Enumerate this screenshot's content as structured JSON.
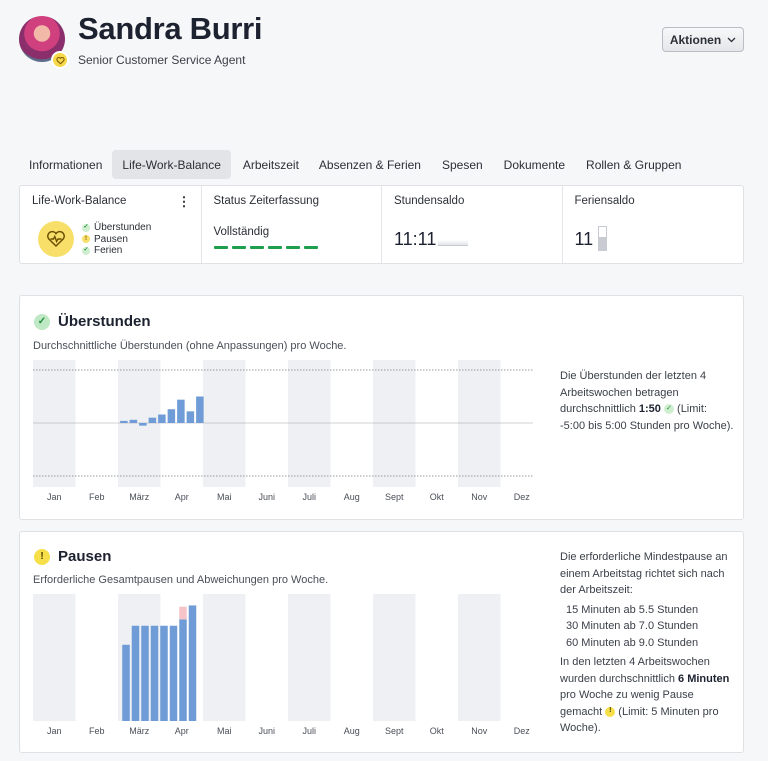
{
  "profile": {
    "name": "Sandra Burri",
    "role": "Senior Customer Service Agent",
    "actions_label": "Aktionen"
  },
  "tabs": [
    {
      "label": "Informationen",
      "active": false
    },
    {
      "label": "Life-Work-Balance",
      "active": true
    },
    {
      "label": "Arbeitszeit",
      "active": false
    },
    {
      "label": "Absenzen & Ferien",
      "active": false
    },
    {
      "label": "Spesen",
      "active": false
    },
    {
      "label": "Dokumente",
      "active": false
    },
    {
      "label": "Rollen & Gruppen",
      "active": false
    }
  ],
  "summary": {
    "lwb": {
      "title": "Life-Work-Balance",
      "items": [
        {
          "label": "Überstunden",
          "status": "ok"
        },
        {
          "label": "Pausen",
          "status": "warning"
        },
        {
          "label": "Ferien",
          "status": "ok"
        }
      ]
    },
    "status": {
      "title": "Status Zeiterfassung",
      "value": "Vollständig"
    },
    "stundensaldo": {
      "title": "Stundensaldo",
      "value": "11:11"
    },
    "feriensaldo": {
      "title": "Feriensaldo",
      "value": "11",
      "gauge_fraction": 0.55
    }
  },
  "ueberstunden": {
    "title": "Überstunden",
    "subtitle": "Durchschnittliche Überstunden (ohne Anpassungen) pro Woche.",
    "text_1": "Die Überstunden der letzten 4 Arbeitswochen betragen durchschnittlich ",
    "avg": "1:50",
    "text_2": " (Limit: -5:00 bis 5:00 Stunden pro Woche)."
  },
  "pausen": {
    "title": "Pausen",
    "subtitle": "Erforderliche Gesamtpausen und Abweichungen pro Woche.",
    "intro": "Die erforderliche Mindestpause an einem Arbeitstag richtet sich nach der Arbeitszeit:",
    "rules": [
      "15 Minuten ab 5.5 Stunden",
      "30 Minuten ab 7.0 Stunden",
      "60 Minuten ab 9.0 Stunden"
    ],
    "text_1": "In den letzten 4 Arbeitswochen wurden durchschnittlich ",
    "avg": "6 Minuten",
    "text_2": " pro Woche zu wenig Pause gemacht ",
    "text_3": " (Limit: 5 Minuten pro Woche)."
  },
  "chart_data": [
    {
      "type": "bar",
      "categories": [
        "Jan",
        "Feb",
        "März",
        "Apr",
        "Mai",
        "Juni",
        "Juli",
        "Aug",
        "Sept",
        "Okt",
        "Nov",
        "Dez"
      ],
      "weeks_start_month": 2.05,
      "series": [
        {
          "values": [
            0.2,
            0.3,
            -0.25,
            0.5,
            0.8,
            1.3,
            2.2,
            1.1,
            2.5
          ]
        }
      ],
      "ylim": [
        -5.0,
        5.0
      ],
      "reference_lines": [
        -5.0,
        0,
        5.0
      ],
      "grid": false,
      "colors": {
        "bar": "#6f9bd6",
        "band": "#eef0f3",
        "line": "#8c9096"
      }
    },
    {
      "type": "bar",
      "categories": [
        "Jan",
        "Feb",
        "März",
        "Apr",
        "Mai",
        "Juni",
        "Juli",
        "Aug",
        "Sept",
        "Okt",
        "Nov",
        "Dez"
      ],
      "weeks_start_month": 2.1,
      "series": [
        {
          "name": "Pausen",
          "values": [
            60,
            75,
            75,
            75,
            75,
            75,
            80,
            91
          ]
        },
        {
          "name": "Abweichung",
          "values": [
            0,
            0,
            0,
            0,
            0,
            0,
            10,
            0
          ]
        }
      ],
      "ylim": [
        0,
        100
      ],
      "grid": false,
      "colors": {
        "bar": "#6f9bd6",
        "deviation": "#f6c3c9",
        "band": "#eef0f3"
      }
    }
  ]
}
